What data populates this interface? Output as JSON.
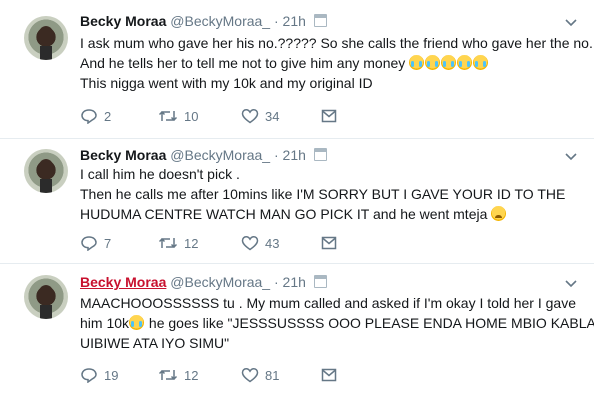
{
  "tweets": [
    {
      "name": "Becky Moraa",
      "handle": "@BeckyMoraa_",
      "separator": "·",
      "time": "21h",
      "lines": [
        "I ask mum who gave her his no.????? So she calls the friend who gave her the no.",
        "And he tells her to tell me not to give him any money",
        "This nigga went with my 10k and my original ID"
      ],
      "replies": "2",
      "retweets": "10",
      "likes": "34"
    },
    {
      "name": "Becky Moraa",
      "handle": "@BeckyMoraa_",
      "separator": "·",
      "time": "21h",
      "lines": [
        "I call him he doesn't pick .",
        "Then he calls me after 10mins like I'M SORRY BUT I GAVE YOUR ID TO THE",
        "HUDUMA CENTRE WATCH MAN GO PICK IT and he went mteja"
      ],
      "replies": "7",
      "retweets": "12",
      "likes": "43"
    },
    {
      "name": "Becky Moraa",
      "handle": "@BeckyMoraa_",
      "separator": "·",
      "time": "21h",
      "lines": [
        "MAACHOOOSSSSSS tu . My mum called and asked if I'm okay I told her I gave",
        "him 10k",
        " he goes like \"JESSSUSSSS OOO PLEASE ENDA HOME MBIO KABLA",
        "UIBIWE ATA IYO SIMU\""
      ],
      "replies": "19",
      "retweets": "12",
      "likes": "81"
    }
  ],
  "icons": {
    "reply": "reply-icon",
    "retweet": "retweet-icon",
    "like": "heart-icon",
    "dm": "envelope-icon",
    "menu": "chevron-down-icon"
  },
  "colors": {
    "name_highlight": "#c8102e",
    "muted": "#657786",
    "divider": "#e6ecf0"
  }
}
